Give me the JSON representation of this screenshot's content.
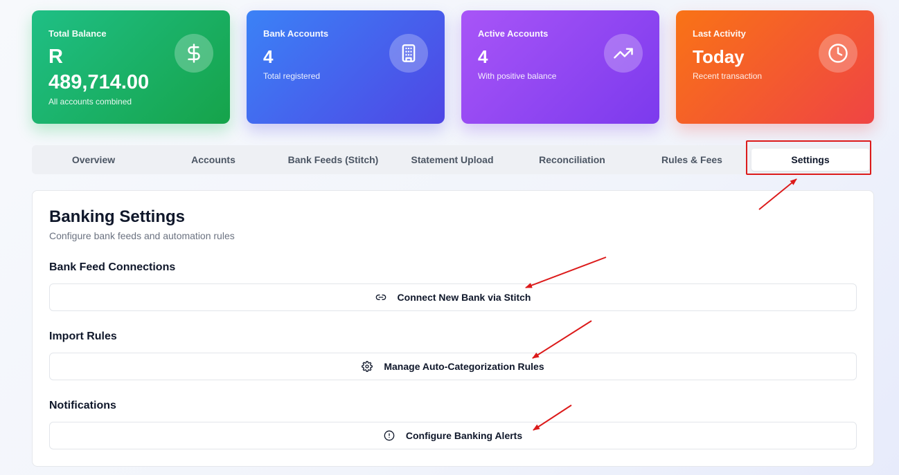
{
  "stats": [
    {
      "label": "Total Balance",
      "value": "R 489,714.00",
      "sub": "All accounts combined",
      "icon": "dollar-icon"
    },
    {
      "label": "Bank Accounts",
      "value": "4",
      "sub": "Total registered",
      "icon": "building-icon"
    },
    {
      "label": "Active Accounts",
      "value": "4",
      "sub": "With positive balance",
      "icon": "trending-up-icon"
    },
    {
      "label": "Last Activity",
      "value": "Today",
      "sub": "Recent transaction",
      "icon": "clock-icon"
    }
  ],
  "tabs": [
    {
      "label": "Overview"
    },
    {
      "label": "Accounts"
    },
    {
      "label": "Bank Feeds (Stitch)"
    },
    {
      "label": "Statement Upload"
    },
    {
      "label": "Reconciliation"
    },
    {
      "label": "Rules & Fees"
    },
    {
      "label": "Settings",
      "active": true
    }
  ],
  "panel": {
    "title": "Banking Settings",
    "description": "Configure bank feeds and automation rules",
    "sections": [
      {
        "title": "Bank Feed Connections",
        "button": "Connect New Bank via Stitch",
        "icon": "link-icon"
      },
      {
        "title": "Import Rules",
        "button": "Manage Auto-Categorization Rules",
        "icon": "gear-icon"
      },
      {
        "title": "Notifications",
        "button": "Configure Banking Alerts",
        "icon": "alert-circle-icon"
      }
    ]
  },
  "colors": {
    "green": "#16a34a",
    "blue": "#4f46e5",
    "purple": "#7c3aed",
    "orange": "#f97316",
    "annotation_red": "#dc1a1a"
  }
}
